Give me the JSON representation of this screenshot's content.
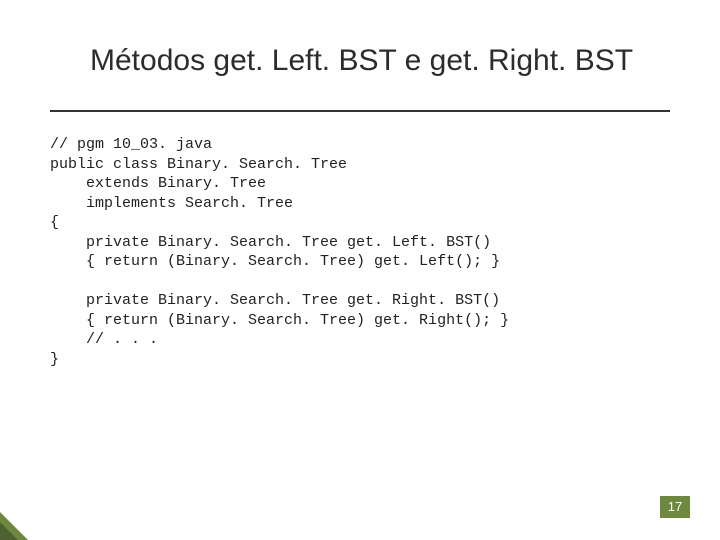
{
  "slide": {
    "title": "Métodos get. Left. BST e get. Right. BST",
    "page_number": "17",
    "code": "// pgm 10_03. java\npublic class Binary. Search. Tree\n    extends Binary. Tree\n    implements Search. Tree\n{\n    private Binary. Search. Tree get. Left. BST()\n    { return (Binary. Search. Tree) get. Left(); }\n\n    private Binary. Search. Tree get. Right. BST()\n    { return (Binary. Search. Tree) get. Right(); }\n    // . . .\n}"
  }
}
